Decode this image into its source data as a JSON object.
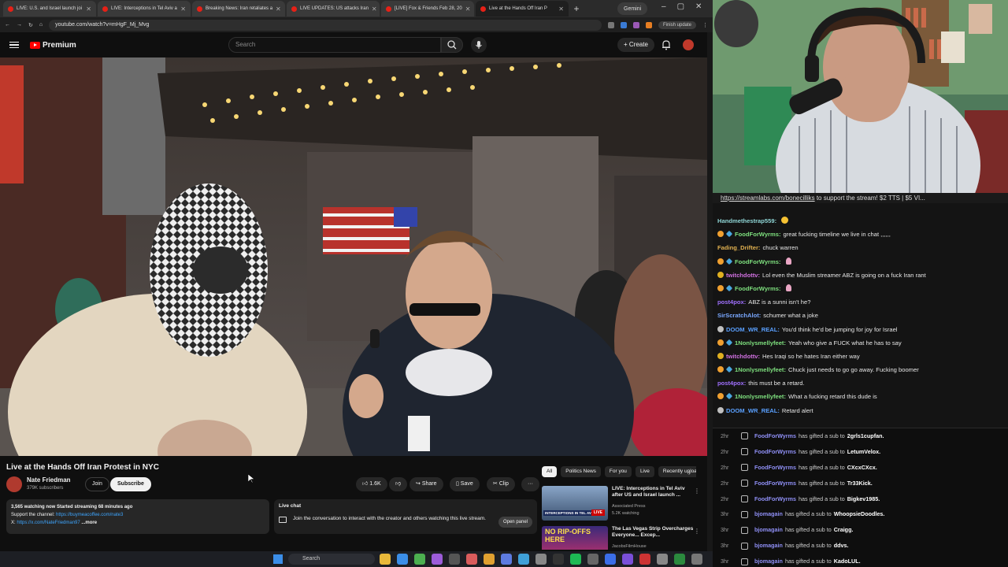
{
  "browser": {
    "tabs": [
      {
        "title": "LIVE: U.S. and Israel launch joi"
      },
      {
        "title": "LIVE: Interceptions in Tel Aviv a"
      },
      {
        "title": "Breaking News: Iran retaliates a"
      },
      {
        "title": "LIVE UPDATES: US attacks Iran"
      },
      {
        "title": "[LIVE] Fox & Friends Feb 28, 20"
      },
      {
        "title": "Live at the Hands Off Iran P"
      }
    ],
    "extra_tab": "Gemini",
    "url": "youtube.com/watch?v=mHgF_Mj_Mvg",
    "finish_update": "Finish update"
  },
  "youtube": {
    "logo_text": "Premium",
    "search_placeholder": "Search",
    "create_label": "+ Create",
    "video": {
      "title": "Live at the Hands Off Iran Protest in NYC",
      "channel": "Nate Friedman",
      "subscribers": "379K subscribers",
      "join": "Join",
      "subscribe": "Subscribe",
      "likes": "1.6K",
      "share": "Share",
      "save": "Save",
      "clip": "Clip",
      "more": "···"
    },
    "description": {
      "line1": "3,565 watching now  Started streaming 68 minutes ago",
      "support_prefix": "Support the channel: ",
      "support_link": "https://buymeacoffee.com/nate3",
      "x_prefix": "X: ",
      "x_link": "https://x.com/NateFriedman97",
      "more": " ...more"
    },
    "livechat": {
      "title": "Live chat",
      "text": "Join the conversation to interact with the creator and others watching this live stream.",
      "open_panel": "Open panel"
    },
    "chips": [
      "All",
      "Politics News",
      "For you",
      "Live",
      "Recently uploaded"
    ],
    "recommendations": [
      {
        "title": "LIVE: Interceptions in Tel Aviv after US and Israel launch ...",
        "channel": "Associated Press",
        "meta": "5.2K watching",
        "thumb_caption": "INTERCEPTIONS IN TEL AVIV",
        "badge": "LIVE"
      },
      {
        "title": "The Las Vegas Strip Overcharges Everyone... Excep...",
        "channel": "JacobsFilmHouse",
        "meta": "",
        "thumb_caption": "NO RIP-OFFS HERE"
      }
    ]
  },
  "stream": {
    "banner_prefix": "",
    "banner_link": "https://streamlabs.com/bonecilliks",
    "banner_suffix": " to support the stream! $2 TTS | $5 VI..."
  },
  "chat": [
    {
      "name": "Handmethestrap559:",
      "color": "#8fd6d6",
      "text": "",
      "badge": "",
      "emote": "face"
    },
    {
      "name": "FoodForWyrms:",
      "color": "#7ee07e",
      "text": "great fucking timeline we live in chat ,,,,,,",
      "badge": "gift"
    },
    {
      "name": "Fading_Drifter:",
      "color": "#e0b050",
      "text": "chuck warren",
      "badge": ""
    },
    {
      "name": "FoodForWyrms:",
      "color": "#7ee07e",
      "text": "",
      "badge": "gift",
      "emote": "pin"
    },
    {
      "name": "twitchdottv:",
      "color": "#d070e0",
      "text": "Lol even the Muslim streamer ABZ is going on a fuck Iran rant",
      "badge": "bits"
    },
    {
      "name": "FoodForWyrms:",
      "color": "#7ee07e",
      "text": "",
      "badge": "gift",
      "emote": "pin"
    },
    {
      "name": "post4pox:",
      "color": "#a070ff",
      "text": "ABZ is a sunni isn't he?",
      "badge": ""
    },
    {
      "name": "SirScratchAlot:",
      "color": "#7aa8ff",
      "text": "schumer what a joke",
      "badge": ""
    },
    {
      "name": "DOOM_WR_REAL:",
      "color": "#5aa0ff",
      "text": "You'd think he'd be jumping for joy for Israel",
      "badge": "mod"
    },
    {
      "name": "1Nonlysmellyfeet:",
      "color": "#7ee07e",
      "text": "Yeah who give a FUCK what he has to say",
      "badge": "gift"
    },
    {
      "name": "twitchdottv:",
      "color": "#d070e0",
      "text": "Hes Iraqi so he hates Iran either way",
      "badge": "bits"
    },
    {
      "name": "1Nonlysmellyfeet:",
      "color": "#7ee07e",
      "text": "Chuck just needs to go go away. Fucking boomer",
      "badge": "gift"
    },
    {
      "name": "post4pox:",
      "color": "#a070ff",
      "text": "this must be a retard.",
      "badge": ""
    },
    {
      "name": "1Nonlysmellyfeet:",
      "color": "#7ee07e",
      "text": "What a fucking retard this dude is",
      "badge": "gift"
    },
    {
      "name": "DOOM_WR_REAL:",
      "color": "#5aa0ff",
      "text": "Retard alert",
      "badge": "mod"
    }
  ],
  "events": [
    {
      "time": "2hr",
      "name": "FoodForWyrms",
      "action": "has gifted a sub to",
      "target": "2grls1cupfan."
    },
    {
      "time": "2hr",
      "name": "FoodForWyrms",
      "action": "has gifted a sub to",
      "target": "LetumVelox."
    },
    {
      "time": "2hr",
      "name": "FoodForWyrms",
      "action": "has gifted a sub to",
      "target": "CXcxCXcx."
    },
    {
      "time": "2hr",
      "name": "FoodForWyrms",
      "action": "has gifted a sub to",
      "target": "Tr33Kick."
    },
    {
      "time": "2hr",
      "name": "FoodForWyrms",
      "action": "has gifted a sub to",
      "target": "Bigkev1985."
    },
    {
      "time": "3hr",
      "name": "bjomagain",
      "action": "has gifted a sub to",
      "target": "WhoopsieDoodles."
    },
    {
      "time": "3hr",
      "name": "bjomagain",
      "action": "has gifted a sub to",
      "target": "Craigg."
    },
    {
      "time": "3hr",
      "name": "bjomagain",
      "action": "has gifted a sub to",
      "target": "ddvs."
    },
    {
      "time": "3hr",
      "name": "bjomagain",
      "action": "has gifted a sub to",
      "target": "KadoLUL."
    }
  ],
  "taskbar": {
    "search": "Search"
  },
  "colors": {
    "bg": "#0f0f0f",
    "accent": "#ff0000",
    "link": "#3ea6ff",
    "event_name": "#8f8ff5"
  }
}
